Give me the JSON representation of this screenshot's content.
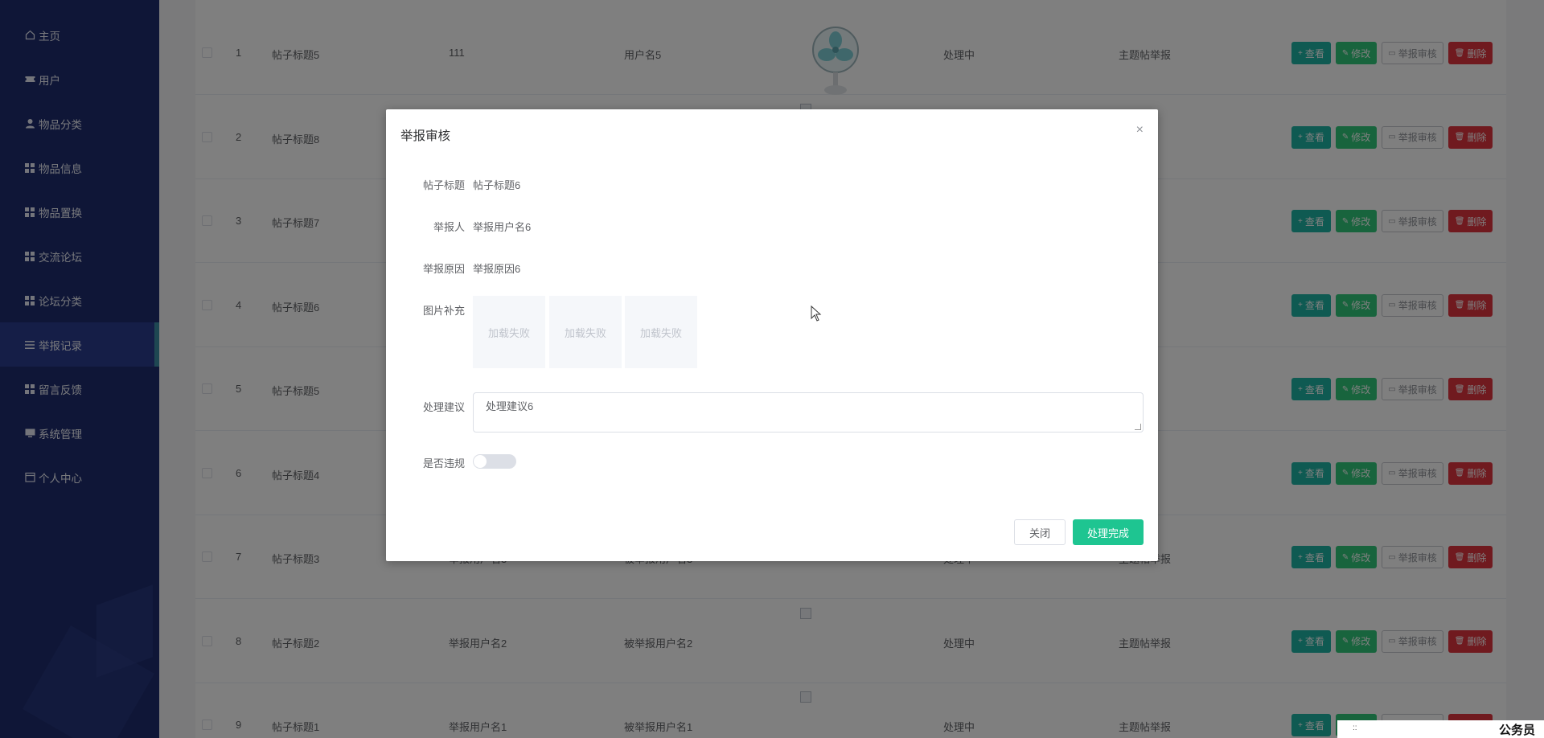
{
  "sidebar": {
    "items": [
      {
        "label": "主页",
        "icon": "home-icon"
      },
      {
        "label": "用户",
        "icon": "ticket-icon"
      },
      {
        "label": "物品分类",
        "icon": "user-icon"
      },
      {
        "label": "物品信息",
        "icon": "grid-icon"
      },
      {
        "label": "物品置换",
        "icon": "grid-icon"
      },
      {
        "label": "交流论坛",
        "icon": "grid-icon"
      },
      {
        "label": "论坛分类",
        "icon": "grid-icon"
      },
      {
        "label": "举报记录",
        "icon": "list-icon"
      },
      {
        "label": "留言反馈",
        "icon": "grid-icon"
      },
      {
        "label": "系统管理",
        "icon": "monitor-icon"
      },
      {
        "label": "个人中心",
        "icon": "calendar-icon"
      }
    ],
    "active_index": 7
  },
  "table": {
    "rows": [
      {
        "index": "1",
        "title": "帖子标题5",
        "reporter": "111",
        "reported": "用户名5",
        "status": "处理中",
        "type": "主题帖举报",
        "image": "fan"
      },
      {
        "index": "2",
        "title": "帖子标题8",
        "reporter": "",
        "reported": "",
        "status": "",
        "type": "报",
        "image": "broken"
      },
      {
        "index": "3",
        "title": "帖子标题7",
        "reporter": "",
        "reported": "",
        "status": "",
        "type": "报",
        "image": ""
      },
      {
        "index": "4",
        "title": "帖子标题6",
        "reporter": "",
        "reported": "",
        "status": "",
        "type": "报",
        "image": ""
      },
      {
        "index": "5",
        "title": "帖子标题5",
        "reporter": "",
        "reported": "",
        "status": "",
        "type": "报",
        "image": ""
      },
      {
        "index": "6",
        "title": "帖子标题4",
        "reporter": "",
        "reported": "",
        "status": "",
        "type": "报",
        "image": ""
      },
      {
        "index": "7",
        "title": "帖子标题3",
        "reporter": "举报用户名3",
        "reported": "被举报用户名3",
        "status": "处理中",
        "type": "主题帖举报",
        "image": ""
      },
      {
        "index": "8",
        "title": "帖子标题2",
        "reporter": "举报用户名2",
        "reported": "被举报用户名2",
        "status": "处理中",
        "type": "主题帖举报",
        "image": "broken"
      },
      {
        "index": "9",
        "title": "帖子标题1",
        "reporter": "举报用户名1",
        "reported": "被举报用户名1",
        "status": "处理中",
        "type": "主题帖举报",
        "image": "broken"
      }
    ],
    "actions": {
      "view": "查看",
      "edit": "修改",
      "audit": "举报审核",
      "delete": "删除"
    }
  },
  "dialog": {
    "title": "举报审核",
    "close_symbol": "×",
    "fields": {
      "post_title_label": "帖子标题",
      "post_title_value": "帖子标题6",
      "reporter_label": "举报人",
      "reporter_value": "举报用户名6",
      "reason_label": "举报原因",
      "reason_value": "举报原因6",
      "images_label": "图片补充",
      "image_failed_text": "加载失败",
      "suggestion_label": "处理建议",
      "suggestion_value": "处理建议6",
      "violation_label": "是否违规",
      "violation_on": false
    },
    "buttons": {
      "close": "关闭",
      "done": "处理完成"
    }
  },
  "corner": {
    "text": "公务员",
    "dots": "::"
  }
}
